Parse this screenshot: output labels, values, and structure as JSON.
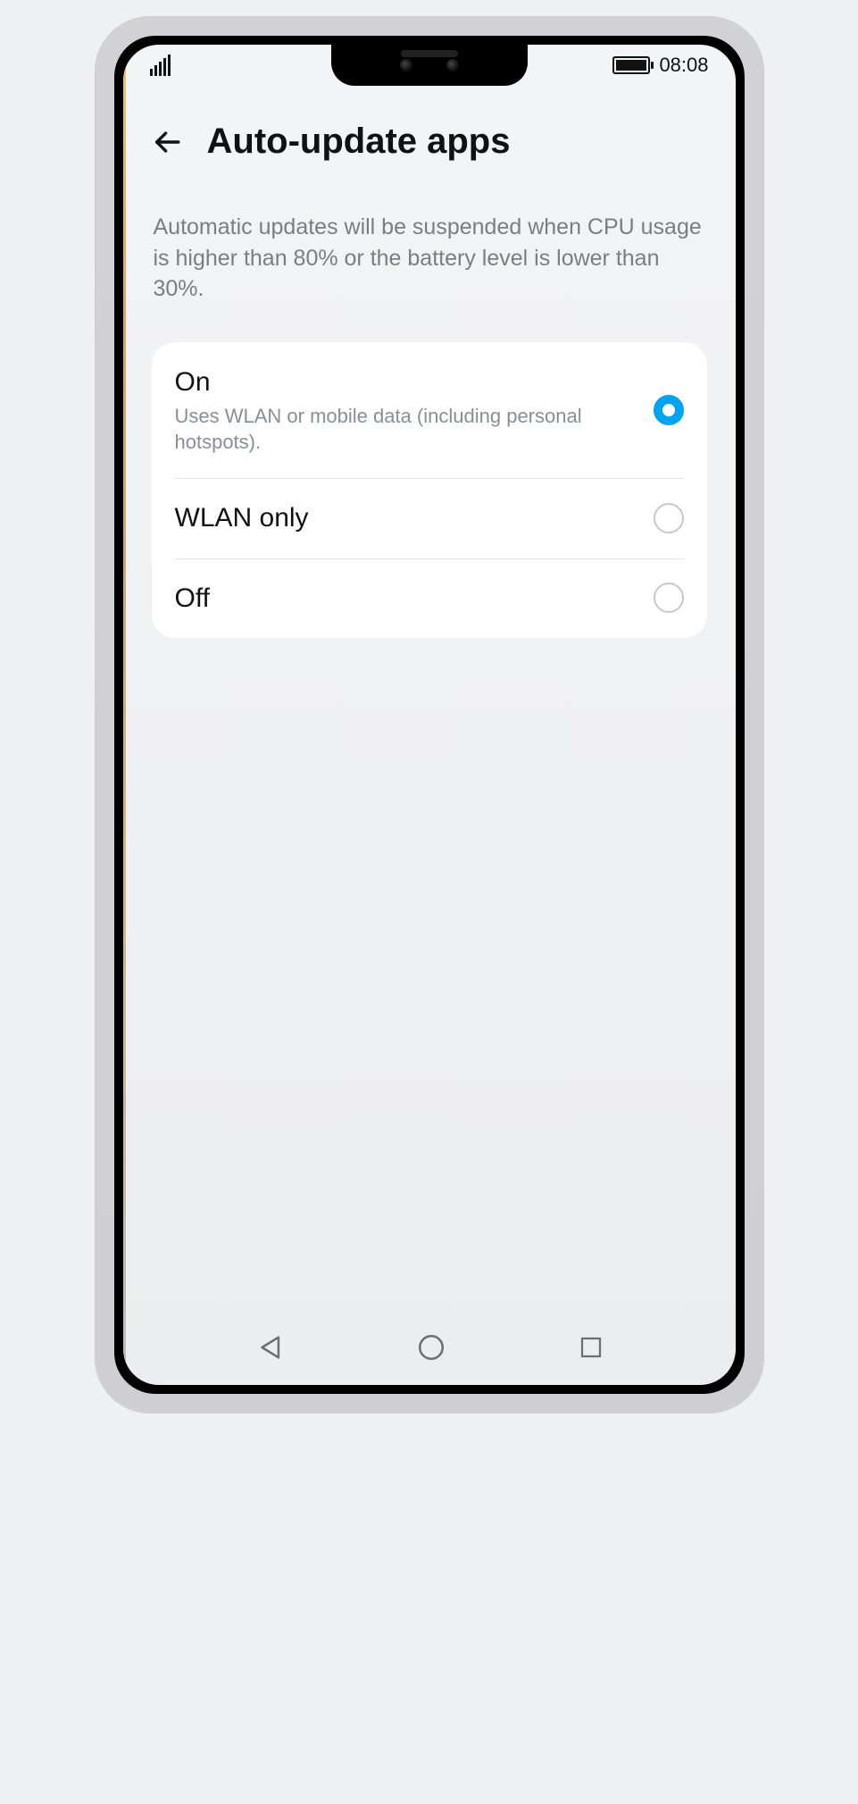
{
  "statusbar": {
    "time": "08:08"
  },
  "header": {
    "title": "Auto-update apps"
  },
  "description": "Automatic updates will be suspended when CPU usage is higher than 80% or the battery level is lower than 30%.",
  "options": [
    {
      "title": "On",
      "subtitle": "Uses WLAN or mobile data (including personal hotspots).",
      "selected": true
    },
    {
      "title": "WLAN only",
      "subtitle": "",
      "selected": false
    },
    {
      "title": "Off",
      "subtitle": "",
      "selected": false
    }
  ]
}
